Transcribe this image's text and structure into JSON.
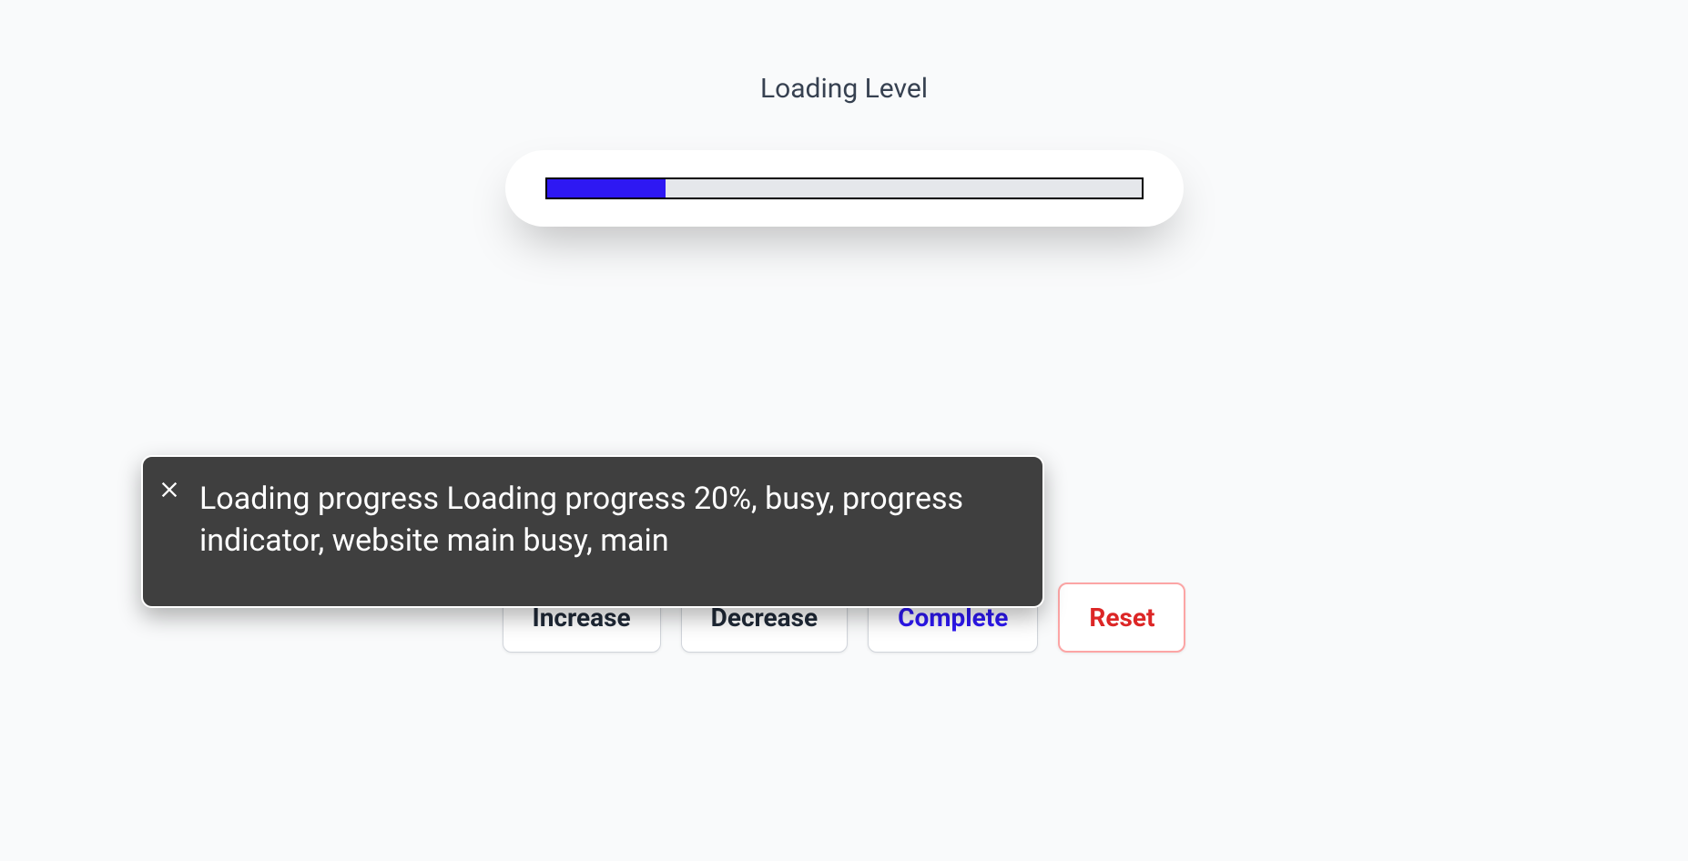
{
  "title": "Loading Level",
  "progress": {
    "percent": 20
  },
  "buttons": {
    "increase": "Increase",
    "decrease": "Decrease",
    "complete": "Complete",
    "reset": "Reset"
  },
  "ariaOverlay": {
    "text": "Loading progress Loading progress 20%, busy, progress indicator, website main busy, main"
  }
}
